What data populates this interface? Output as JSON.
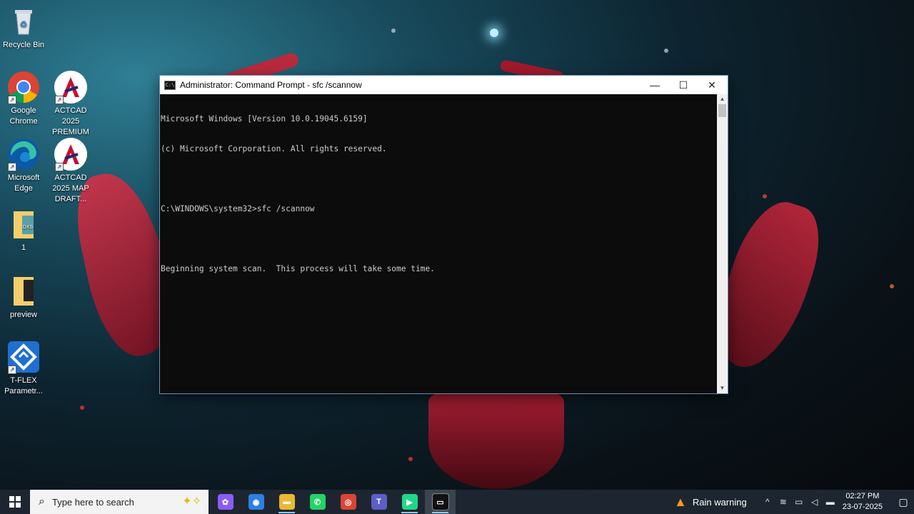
{
  "desktop": {
    "icons": [
      {
        "label": "Recycle Bin",
        "icon": "recycle-bin-icon"
      },
      {
        "label": "Google Chrome",
        "icon": "chrome-icon"
      },
      {
        "label": "ACTCAD 2025 PREMIUM",
        "icon": "actcad-icon"
      },
      {
        "label": "Microsoft Edge",
        "icon": "edge-icon"
      },
      {
        "label": "ACTCAD 2025 MAP DRAFT...",
        "icon": "actcad-icon"
      },
      {
        "label": "1",
        "icon": "folder-icon"
      },
      {
        "label": "preview",
        "icon": "folder-icon"
      },
      {
        "label": "T-FLEX Parametr...",
        "icon": "tflex-icon"
      }
    ]
  },
  "window": {
    "title": "Administrator: Command Prompt - sfc  /scannow",
    "icon_text": "C:\\",
    "minimize": "—",
    "maximize": "☐",
    "close": "✕"
  },
  "console": {
    "lines": [
      "Microsoft Windows [Version 10.0.19045.6159]",
      "(c) Microsoft Corporation. All rights reserved.",
      "",
      "C:\\WINDOWS\\system32>sfc /scannow",
      "",
      "Beginning system scan.  This process will take some time."
    ]
  },
  "taskbar": {
    "search_placeholder": "Type here to search",
    "apps": [
      {
        "name": "copilot",
        "glyph": "✿",
        "color": "#8a5cf6",
        "running": false
      },
      {
        "name": "screen-recorder",
        "glyph": "◉",
        "color": "#2d7fe0",
        "running": false
      },
      {
        "name": "file-explorer",
        "glyph": "▬",
        "color": "#e8b931",
        "running": true
      },
      {
        "name": "whatsapp",
        "glyph": "✆",
        "color": "#25d366",
        "running": false
      },
      {
        "name": "chrome",
        "glyph": "◎",
        "color": "#db4437",
        "running": false
      },
      {
        "name": "teams",
        "glyph": "T",
        "color": "#5b5fc7",
        "running": false
      },
      {
        "name": "pycharm",
        "glyph": "▶",
        "color": "#21d789",
        "running": true
      },
      {
        "name": "command-prompt",
        "glyph": "▭",
        "color": "#111111",
        "running": true
      }
    ],
    "weather": "Rain warning",
    "time": "02:27 PM",
    "date": "23-07-2025"
  }
}
